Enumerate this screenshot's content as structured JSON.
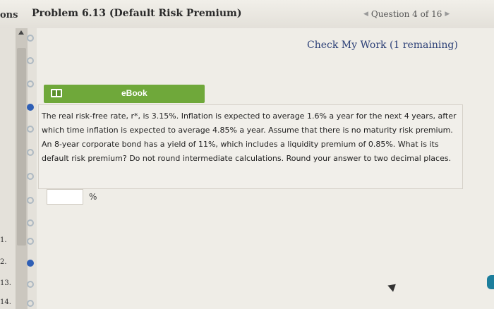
{
  "header": {
    "side_fragment": "ons",
    "problem_title": "Problem 6.13 (Default Risk Premium)",
    "question_counter": "Question 4 of 16",
    "prev_glyph": "◀",
    "next_glyph": "▶"
  },
  "sidebar": {
    "items": [
      {
        "state": "hollow",
        "label": ""
      },
      {
        "state": "hollow",
        "label": ""
      },
      {
        "state": "hollow",
        "label": ""
      },
      {
        "state": "filled",
        "label": ""
      },
      {
        "state": "hollow",
        "label": ""
      },
      {
        "state": "hollow",
        "label": ""
      },
      {
        "state": "hollow",
        "label": ""
      },
      {
        "state": "hollow",
        "label": ""
      },
      {
        "state": "hollow",
        "label": ""
      },
      {
        "state": "hollow",
        "label": "1."
      },
      {
        "state": "filled",
        "label": "2."
      },
      {
        "state": "hollow",
        "label": "13."
      },
      {
        "state": "hollow",
        "label": "14."
      }
    ]
  },
  "main": {
    "check_work": "Check My Work (1 remaining)",
    "ebook_label": "eBook",
    "question_text": "The real risk-free rate, r*, is 3.15%. Inflation is expected to average 1.6% a year for the next 4 years, after which time inflation is expected to average 4.85% a year. Assume that there is no maturity risk premium. An 8-year corporate bond has a yield of 11%, which includes a liquidity premium of 0.85%. What is its default risk premium? Do not round intermediate calculations. Round your answer to two decimal places.",
    "answer_value": "",
    "answer_unit": "%"
  },
  "colors": {
    "accent_blue": "#2f5fb5",
    "ebook_green": "#6fa83a",
    "link_blue": "#2b3f76"
  }
}
